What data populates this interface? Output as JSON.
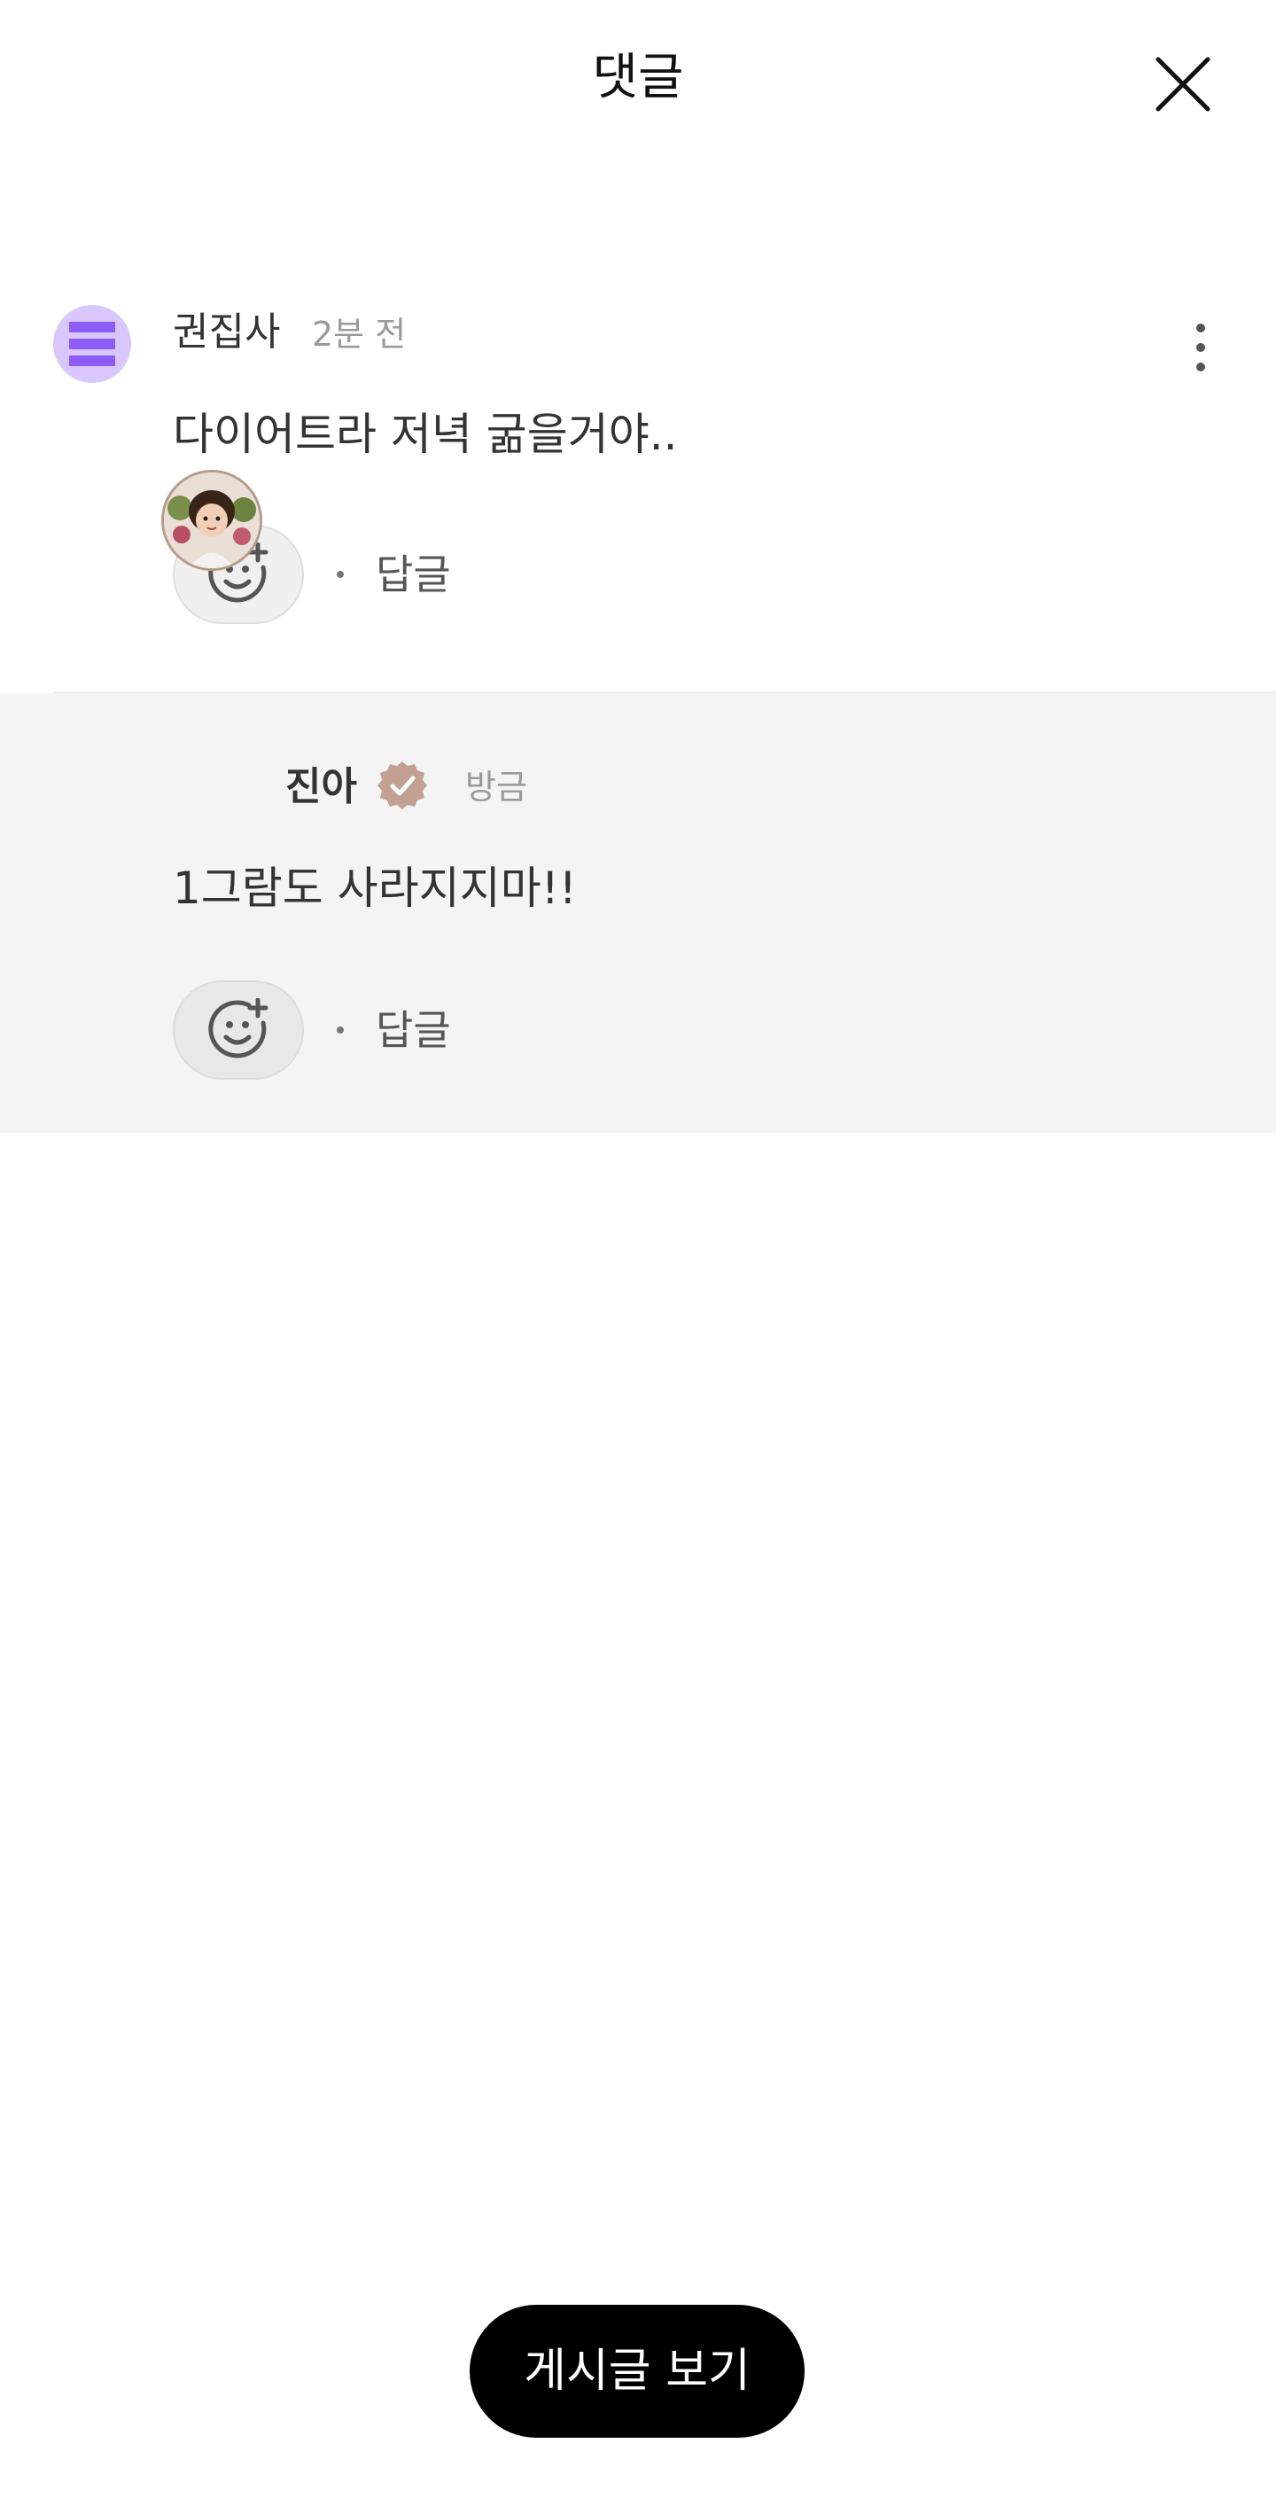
{
  "header": {
    "title": "댓글",
    "close_icon": "close-icon"
  },
  "comments": [
    {
      "author": "권집사",
      "time": "2분 전",
      "text": "다이어트라 저녁 굶을거야..",
      "reply_label": "답글",
      "avatar_icon": "stack-icon",
      "avatar_color": "#8b5cf6"
    },
    {
      "author": "진아",
      "time": "방금",
      "text": "1그람도 사라지지마!!",
      "reply_label": "답글",
      "badge_icon": "verified-badge-icon",
      "badge_color": "#c2a192"
    }
  ],
  "footer": {
    "view_post_label": "게시글 보기"
  }
}
